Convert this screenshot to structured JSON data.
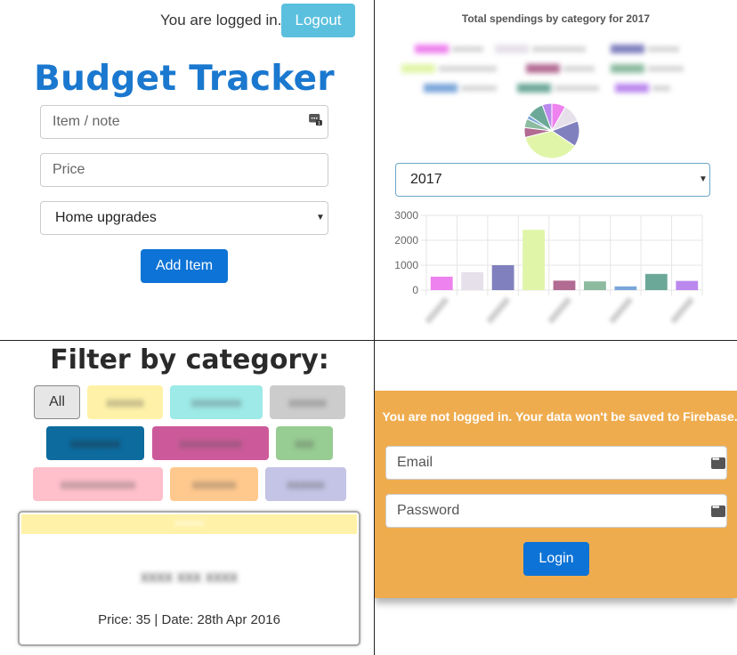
{
  "auth": {
    "status": "You are logged in.",
    "logout_label": "Logout"
  },
  "app": {
    "title": "Budget Tracker"
  },
  "form": {
    "item_placeholder": "Item / note",
    "price_placeholder": "Price",
    "category_selected": "Home upgrades",
    "add_label": "Add Item"
  },
  "chart": {
    "title": "Total spendings by category for 2017",
    "year_selected": "2017"
  },
  "chart_data": [
    {
      "type": "pie",
      "title": "Total spendings by category for 2017",
      "legend_position": "top",
      "values": [
        540,
        720,
        1000,
        2420,
        380,
        350,
        150,
        650,
        370
      ],
      "colors": [
        "#ee82ee",
        "#e6e0ea",
        "#8080bf",
        "#e0f5a8",
        "#b26b92",
        "#8cbba0",
        "#7ba6da",
        "#6ca898",
        "#bb88ee"
      ]
    },
    {
      "type": "bar",
      "ylim": [
        0,
        3000
      ],
      "yticks": [
        "0",
        "1000",
        "2000",
        "3000"
      ],
      "values": [
        540,
        720,
        1000,
        2420,
        380,
        350,
        150,
        650,
        370
      ],
      "colors": [
        "#ee82ee",
        "#e6e0ea",
        "#8080bf",
        "#e0f5a8",
        "#b26b92",
        "#8cbba0",
        "#7ba6da",
        "#6ca898",
        "#bb88ee"
      ],
      "grid": true
    }
  ],
  "filter": {
    "title": "Filter by category:",
    "all_label": "All",
    "categories": [
      {
        "color": "#fff2a8"
      },
      {
        "color": "#9deae8"
      },
      {
        "color": "#cccccc"
      },
      {
        "color": "#0d6b9e"
      },
      {
        "color": "#cc5a9a"
      },
      {
        "color": "#97cc92"
      },
      {
        "color": "#ffc0cb"
      },
      {
        "color": "#ffc98e"
      },
      {
        "color": "#c4c4e6"
      }
    ]
  },
  "card": {
    "meta": "Price: 35 | Date: 28th Apr 2016"
  },
  "login": {
    "message": "You are not logged in. Your data won't be saved to Firebase.",
    "email_placeholder": "Email",
    "password_placeholder": "Password",
    "login_label": "Login"
  }
}
